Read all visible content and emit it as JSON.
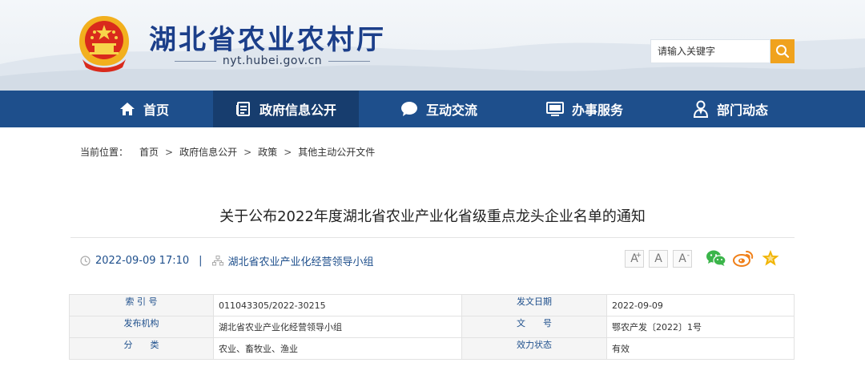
{
  "header": {
    "site_title": "湖北省农业农村厅",
    "domain": "nyt.hubei.gov.cn",
    "search_placeholder": "请输入关键字"
  },
  "nav": {
    "items": [
      {
        "label": "首页",
        "icon": "home-icon"
      },
      {
        "label": "政府信息公开",
        "icon": "document-icon",
        "active": true
      },
      {
        "label": "互动交流",
        "icon": "chat-bubble-icon"
      },
      {
        "label": "办事服务",
        "icon": "monitor-icon"
      },
      {
        "label": "部门动态",
        "icon": "person-icon"
      }
    ]
  },
  "breadcrumb": {
    "prefix": "当前位置：",
    "items": [
      "首页",
      "政府信息公开",
      "政策",
      "其他主动公开文件"
    ],
    "separator": ">"
  },
  "article": {
    "title": "关于公布2022年度湖北省农业产业化省级重点龙头企业名单的通知",
    "datetime": "2022-09-09 17:10",
    "pipe": "|",
    "source": "湖北省农业产业化经营领导小组"
  },
  "toolbar": {
    "font_larger": "A",
    "font_larger_mark": "+",
    "font_reset": "A",
    "font_smaller": "A",
    "font_smaller_mark": "-"
  },
  "share": {
    "icons": [
      "wechat-icon",
      "weibo-icon",
      "favorite-star-icon"
    ]
  },
  "info_table": {
    "rows": [
      {
        "k1": "索 引 号",
        "v1": "011043305/2022-30215",
        "k2": "发文日期",
        "v2": "2022-09-09"
      },
      {
        "k1": "发布机构",
        "v1": "湖北省农业产业化经营领导小组",
        "k2": "文　　号",
        "v2": "鄂农产发〔2022〕1号"
      },
      {
        "k1": "分　　类",
        "v1": "农业、畜牧业、渔业",
        "k2": "效力状态",
        "v2": "有效"
      }
    ]
  },
  "colors": {
    "nav_bg": "#1e4f8c",
    "nav_active_bg": "#173d6e",
    "title_blue": "#1c3f8a",
    "search_button": "#f0a21d",
    "wechat_green": "#3bb54a",
    "weibo_orange": "#f08019",
    "star_gold": "#f1b400"
  }
}
